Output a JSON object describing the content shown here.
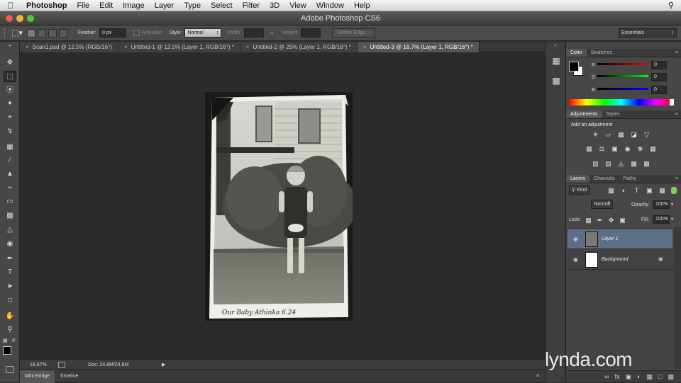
{
  "menubar": {
    "app_name": "Photoshop",
    "items": [
      "File",
      "Edit",
      "Image",
      "Layer",
      "Type",
      "Select",
      "Filter",
      "3D",
      "View",
      "Window",
      "Help"
    ]
  },
  "window": {
    "title": "Adobe Photoshop CS6"
  },
  "options": {
    "feather_label": "Feather:",
    "feather_value": "0 px",
    "antialias_label": "Anti-alias",
    "style_label": "Style:",
    "style_value": "Normal",
    "width_label": "Width:",
    "height_label": "Height:",
    "refine_edge_label": "Refine Edge...",
    "workspace_value": "Essentials"
  },
  "tabs": [
    {
      "label": "Scan1.psd @ 12.5% (RGB/16°)"
    },
    {
      "label": "Untitled-1 @ 12.5% (Layer 1, RGB/16°) *"
    },
    {
      "label": "Untitled-2 @ 25% (Layer 1, RGB/16°) *"
    },
    {
      "label": "Untitled-3 @ 16.7% (Layer 1, RGB/16°) *"
    }
  ],
  "status": {
    "zoom": "16.67%",
    "doc": "Doc: 24.8M/24.8M"
  },
  "bottom_tabs": [
    "Mini Bridge",
    "Timeline"
  ],
  "color_panel": {
    "tabs": [
      "Color",
      "Swatches"
    ],
    "channels": [
      {
        "label": "R",
        "value": "0"
      },
      {
        "label": "G",
        "value": "0"
      },
      {
        "label": "B",
        "value": "0"
      }
    ]
  },
  "adjustments_panel": {
    "tabs": [
      "Adjustments",
      "Styles"
    ],
    "heading": "Add an adjustment"
  },
  "layers_panel": {
    "tabs": [
      "Layers",
      "Channels",
      "Paths"
    ],
    "filter_value": "Kind",
    "blend_mode": "Normal",
    "opacity_label": "Opacity:",
    "opacity_value": "100%",
    "lock_label": "Lock:",
    "fill_label": "Fill:",
    "fill_value": "100%",
    "layers": [
      {
        "name": "Layer 1",
        "selected": true
      },
      {
        "name": "Background",
        "selected": false
      }
    ]
  },
  "photo": {
    "caption": "Our Baby Athinka 6.24"
  },
  "watermark": "lynda.com",
  "colors": {
    "accent_selection": "#5d6f86",
    "canvas_bg": "#2b2b2b",
    "panel_bg": "#474747"
  }
}
